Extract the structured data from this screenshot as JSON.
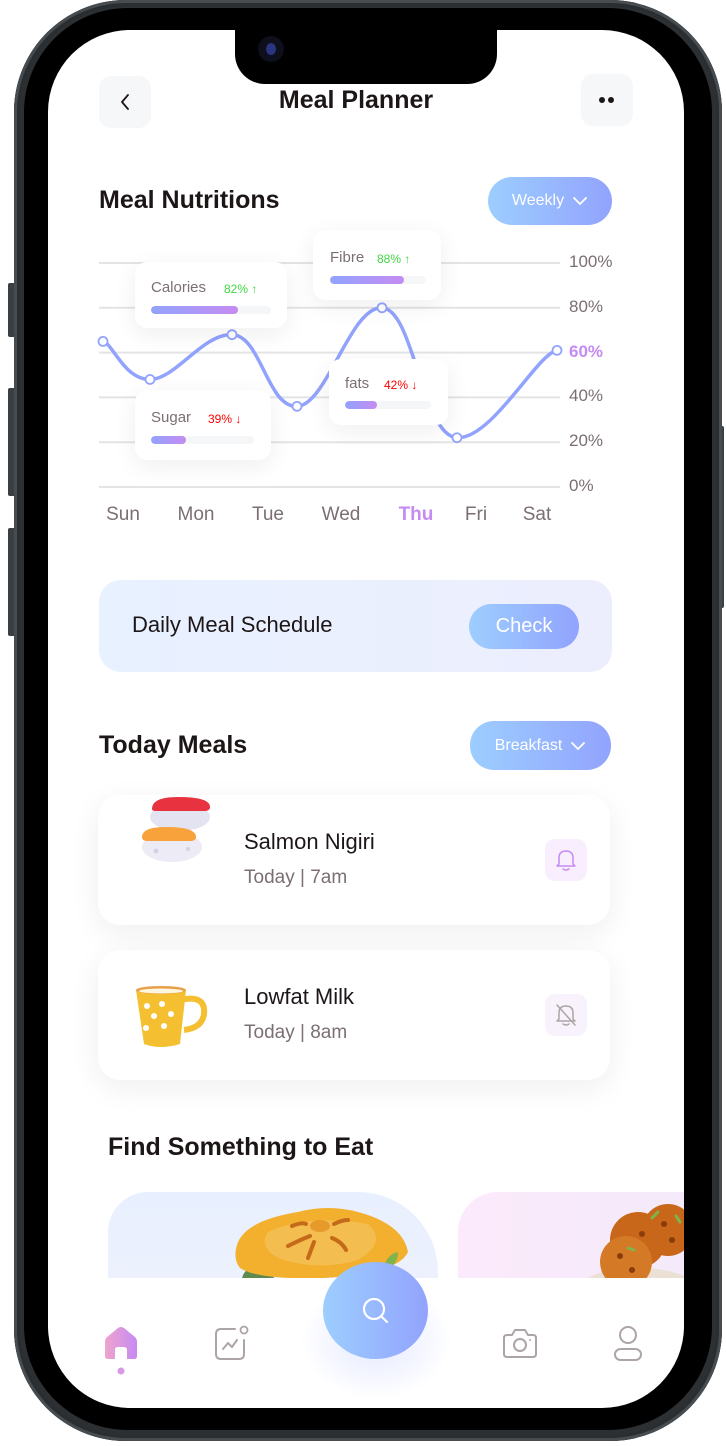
{
  "header": {
    "title": "Meal Planner",
    "back_icon": "chevron-left-icon",
    "more_icon": "more-dots-icon"
  },
  "nutrition": {
    "title": "Meal Nutritions",
    "period_selector": "Weekly",
    "cards": [
      {
        "label": "Calories",
        "percent": "82%",
        "trend": "up",
        "arrow": "↑",
        "value": 0.82
      },
      {
        "label": "Fibre",
        "percent": "88%",
        "trend": "up",
        "arrow": "↑",
        "value": 0.88
      },
      {
        "label": "Sugar",
        "percent": "39%",
        "trend": "down",
        "arrow": "↓",
        "value": 0.39
      },
      {
        "label": "fats",
        "percent": "42%",
        "trend": "down",
        "arrow": "↓",
        "value": 0.42
      }
    ],
    "colors": {
      "up": "#42d742",
      "down": "#ff0000",
      "highlight": "#c58bf2",
      "line": "#92a3fd"
    }
  },
  "chart_data": {
    "type": "line",
    "title": "Meal Nutritions",
    "categories": [
      "Sun",
      "Mon",
      "Tue",
      "Wed",
      "Thu",
      "Fri",
      "Sat"
    ],
    "x_highlight": "Thu",
    "series": [
      {
        "name": "Nutrition",
        "values": [
          65,
          48,
          68,
          36,
          80,
          22,
          61
        ]
      }
    ],
    "y_ticks": [
      "100%",
      "80%",
      "60%",
      "40%",
      "20%",
      "0%"
    ],
    "y_tick_values": [
      100,
      80,
      60,
      40,
      20,
      0
    ],
    "y_highlight": "60%",
    "ylim": [
      0,
      100
    ],
    "grid": true,
    "xlabel": "",
    "ylabel": ""
  },
  "schedule": {
    "title": "Daily Meal Schedule",
    "button": "Check"
  },
  "today_meals": {
    "title": "Today Meals",
    "selector": "Breakfast",
    "items": [
      {
        "name": "Salmon Nigiri",
        "time": "Today | 7am",
        "image": "sushi-image",
        "notify": true
      },
      {
        "name": "Lowfat Milk",
        "time": "Today | 8am",
        "image": "cup-image",
        "notify": false
      }
    ]
  },
  "find": {
    "title": "Find Something to Eat",
    "cards": [
      {
        "image": "pie-image"
      },
      {
        "image": "cookies-image"
      }
    ]
  },
  "nav": {
    "items": [
      {
        "name": "home",
        "icon": "home-icon",
        "active": true
      },
      {
        "name": "activity",
        "icon": "activity-icon",
        "active": false
      },
      {
        "name": "search",
        "icon": "search-icon",
        "active": false
      },
      {
        "name": "camera",
        "icon": "camera-icon",
        "active": false
      },
      {
        "name": "profile",
        "icon": "profile-icon",
        "active": false
      }
    ]
  }
}
